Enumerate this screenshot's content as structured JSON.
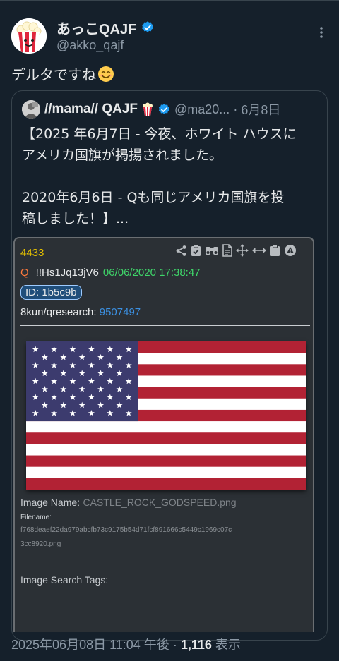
{
  "tweet": {
    "display_name": "あっこQAJF",
    "handle": "@akko_qajf",
    "text": "デルタですね",
    "avatar_icon": "popcorn-icon",
    "verified_icon": "verified-badge-icon",
    "emoji": "smiling-face-icon"
  },
  "quote": {
    "display_name": "//mama// QAJF",
    "handle": "@ma20...",
    "separator": "·",
    "date": "6月8日",
    "text": "【2025 年6月7日 - 今夜、ホワイト ハウスに\nアメリカ国旗が掲揚されました。\n\n2020年6月6日 - Qも同じアメリカ国旗を投\n稿しました！】..."
  },
  "post_image": {
    "post_number": "4433",
    "poster": "Q",
    "tripcode": "!!Hs1Jq13jV6",
    "timestamp": "06/06/2020 17:38:47",
    "id_label": "ID: 1b5c9b",
    "board_label": "8kun/qresearch:",
    "board_post": "9507497",
    "image_name_label": "Image Name:",
    "image_name_value": "CASTLE_ROCK_GODSPEED.png",
    "filename_label": "Filename:",
    "filename_line1": "f768deaef22da979abcfb73c9175b54d71fcf891666c5449c1969c07c",
    "filename_line2": "3cc8920.png",
    "search_tags_label": "Image Search Tags:",
    "tool_icons": [
      "share-icon",
      "clipboard-check-icon",
      "binoculars-icon",
      "document-icon",
      "move-icon",
      "resize-horizontal-icon",
      "clipboard-icon",
      "warning-icon"
    ]
  },
  "footer": {
    "timestamp": "2025年06月08日 11:04 午後",
    "separator": "·",
    "views_count": "1,116",
    "views_label": "表示"
  },
  "colors": {
    "background": "#15202b",
    "verified": "#1d9bf0",
    "secondary_text": "#8b98a5",
    "flag_red": "#b22234",
    "flag_blue": "#3c3b6e"
  }
}
